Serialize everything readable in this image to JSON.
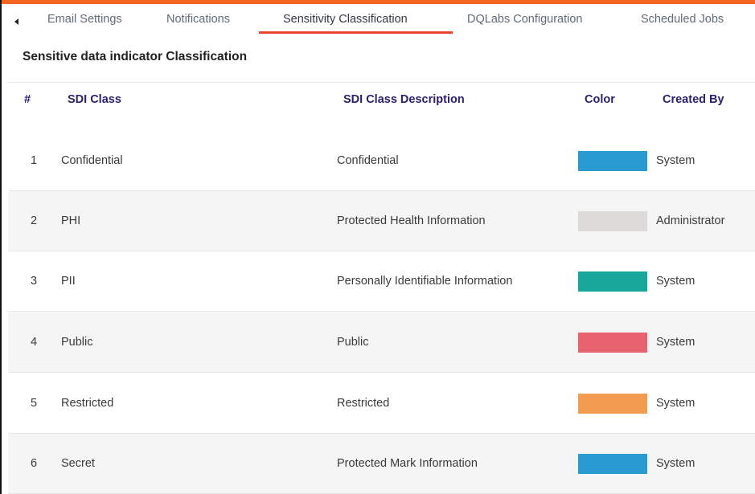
{
  "tabs": [
    {
      "label": "Email Settings"
    },
    {
      "label": "Notifications"
    },
    {
      "label": "Sensitivity Classification"
    },
    {
      "label": "DQLabs Configuration"
    },
    {
      "label": "Scheduled Jobs"
    }
  ],
  "active_tab": "Sensitivity Classification",
  "section": {
    "title": "Sensitive data indicator Classification"
  },
  "table": {
    "headers": {
      "num": "#",
      "class": "SDI Class",
      "description": "SDI Class Description",
      "color": "Color",
      "created_by": "Created By"
    },
    "rows": [
      {
        "num": "1",
        "class": "Confidential",
        "description": "Confidential",
        "color": "#2a9bd1",
        "created_by": "System"
      },
      {
        "num": "2",
        "class": "PHI",
        "description": "Protected Health Information",
        "color": "#dcdbd8",
        "created_by": "Administrator"
      },
      {
        "num": "3",
        "class": "PII",
        "description": "Personally Identifiable Information",
        "color": "#17a89b",
        "created_by": "System"
      },
      {
        "num": "4",
        "class": "Public",
        "description": "Public",
        "color": "#e86270",
        "created_by": "System"
      },
      {
        "num": "5",
        "class": "Restricted",
        "description": "Restricted",
        "color": "#f39c4f",
        "created_by": "System"
      },
      {
        "num": "6",
        "class": "Secret",
        "description": "Protected Mark Information",
        "color": "#2a9bd1",
        "created_by": "System"
      }
    ]
  },
  "colors": {
    "accent": "#f26522",
    "tab_underline": "#e8452c",
    "header_text": "#2b1e6b"
  }
}
